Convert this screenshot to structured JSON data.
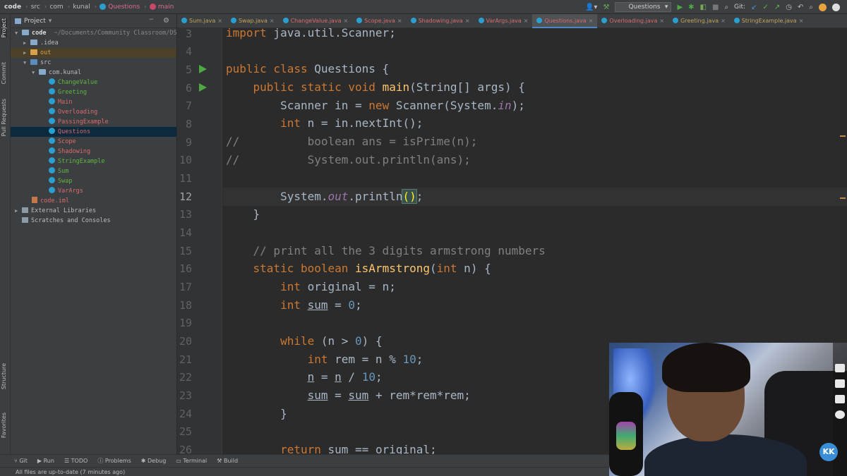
{
  "breadcrumb": {
    "items": [
      "code",
      "src",
      "com",
      "kunal",
      "Questions",
      "main"
    ]
  },
  "toolbar": {
    "run_config": "Questions",
    "git_label": "Git:"
  },
  "left_strip": {
    "project": "Project",
    "commit": "Commit",
    "pull_requests": "Pull Requests",
    "structure": "Structure",
    "favorites": "Favorites"
  },
  "project_panel": {
    "title": "Project",
    "root_name": "code",
    "root_path": "~/Documents/Community Classroom/DS",
    "idea": ".idea",
    "out": "out",
    "src": "src",
    "package": "com.kunal",
    "classes": [
      "ChangeValue",
      "Greeting",
      "Main",
      "Overloading",
      "PassingExample",
      "Questions",
      "Scope",
      "Shadowing",
      "StringExample",
      "Sum",
      "Swap",
      "VarArgs"
    ],
    "iml": "code.iml",
    "external": "External Libraries",
    "scratches": "Scratches and Consoles"
  },
  "tabs": [
    "Sum.java",
    "Swap.java",
    "ChangeValue.java",
    "Scope.java",
    "Shadowing.java",
    "VarArgs.java",
    "Questions.java",
    "Overloading.java",
    "Greeting.java",
    "StringExample.java"
  ],
  "active_tab": "Questions.java",
  "line_numbers": [
    "3",
    "4",
    "5",
    "6",
    "7",
    "8",
    "9",
    "10",
    "11",
    "12",
    "13",
    "14",
    "15",
    "16",
    "17",
    "18",
    "19",
    "20",
    "21",
    "22",
    "23",
    "24",
    "25",
    "26"
  ],
  "tool_windows": [
    "Git",
    "Run",
    "TODO",
    "Problems",
    "Debug",
    "Terminal",
    "Build"
  ],
  "status": "All files are up-to-date (7 minutes ago)",
  "webcam_badge": "KK",
  "colors": {
    "editor_bg": "#2b2b2b",
    "panel_bg": "#3c3f41",
    "keyword": "#cc7832",
    "comment": "#808080",
    "field": "#9876aa",
    "number": "#6897bb",
    "method": "#ffc66d"
  }
}
